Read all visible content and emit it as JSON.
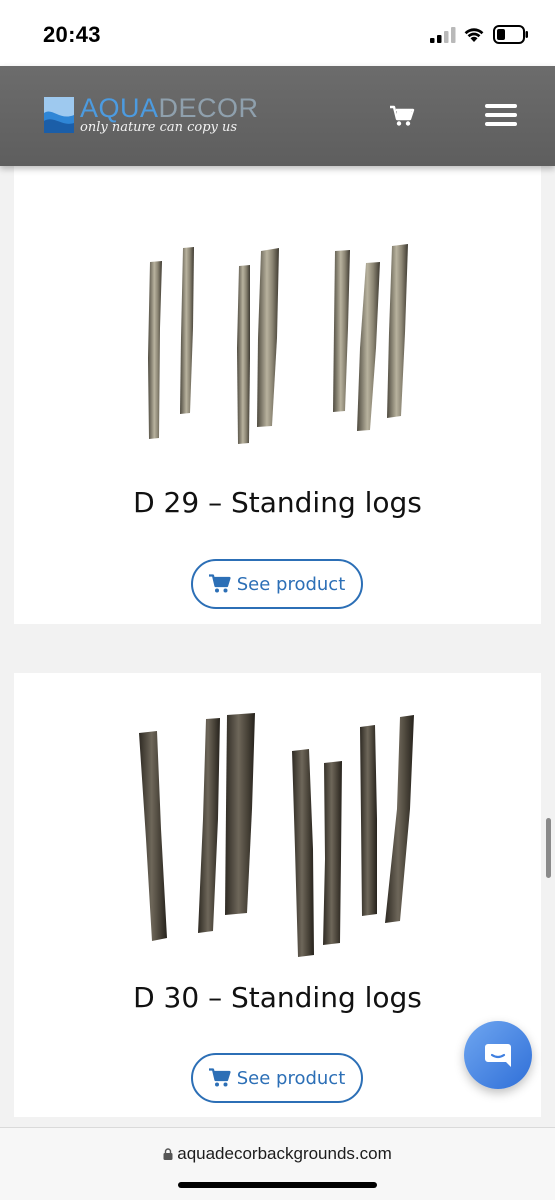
{
  "status_bar": {
    "time": "20:43"
  },
  "header": {
    "logo_aqua": "AQUA",
    "logo_decor": "DECOR",
    "tagline": "only nature can copy us",
    "cart_icon": "cart-icon",
    "menu_icon": "hamburger-menu-icon"
  },
  "products": [
    {
      "title": "D 29 – Standing logs",
      "button_label": "See product",
      "image": "standing-logs-birch"
    },
    {
      "title": "D 30 – Standing logs",
      "button_label": "See product",
      "image": "standing-logs-dark"
    }
  ],
  "chat": {
    "icon": "chat-bubble-icon"
  },
  "browser": {
    "url": "aquadecorbackgrounds.com"
  },
  "colors": {
    "header_bg": "#616161",
    "accent_blue": "#2c6fb6",
    "chat_blue": "#3f7fe0"
  }
}
